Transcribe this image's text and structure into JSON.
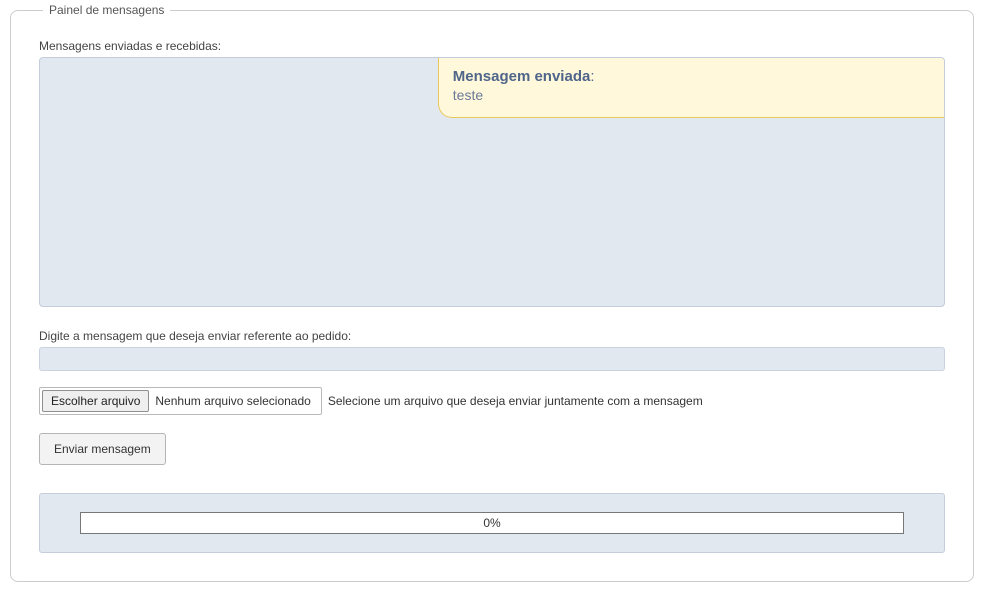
{
  "panel": {
    "legend": "Painel de mensagens",
    "messages_label": "Mensagens enviadas e recebidas:",
    "messages": [
      {
        "title": "Mensagem enviada",
        "body": "teste"
      }
    ],
    "compose_label": "Digite a mensagem que deseja enviar referente ao pedido:",
    "compose_value": "",
    "file": {
      "choose_button": "Escolher arquivo",
      "status": "Nenhum arquivo selecionado",
      "hint": "Selecione um arquivo que deseja enviar juntamente com a mensagem"
    },
    "send_button": "Enviar mensagem",
    "progress_text": "0%"
  }
}
